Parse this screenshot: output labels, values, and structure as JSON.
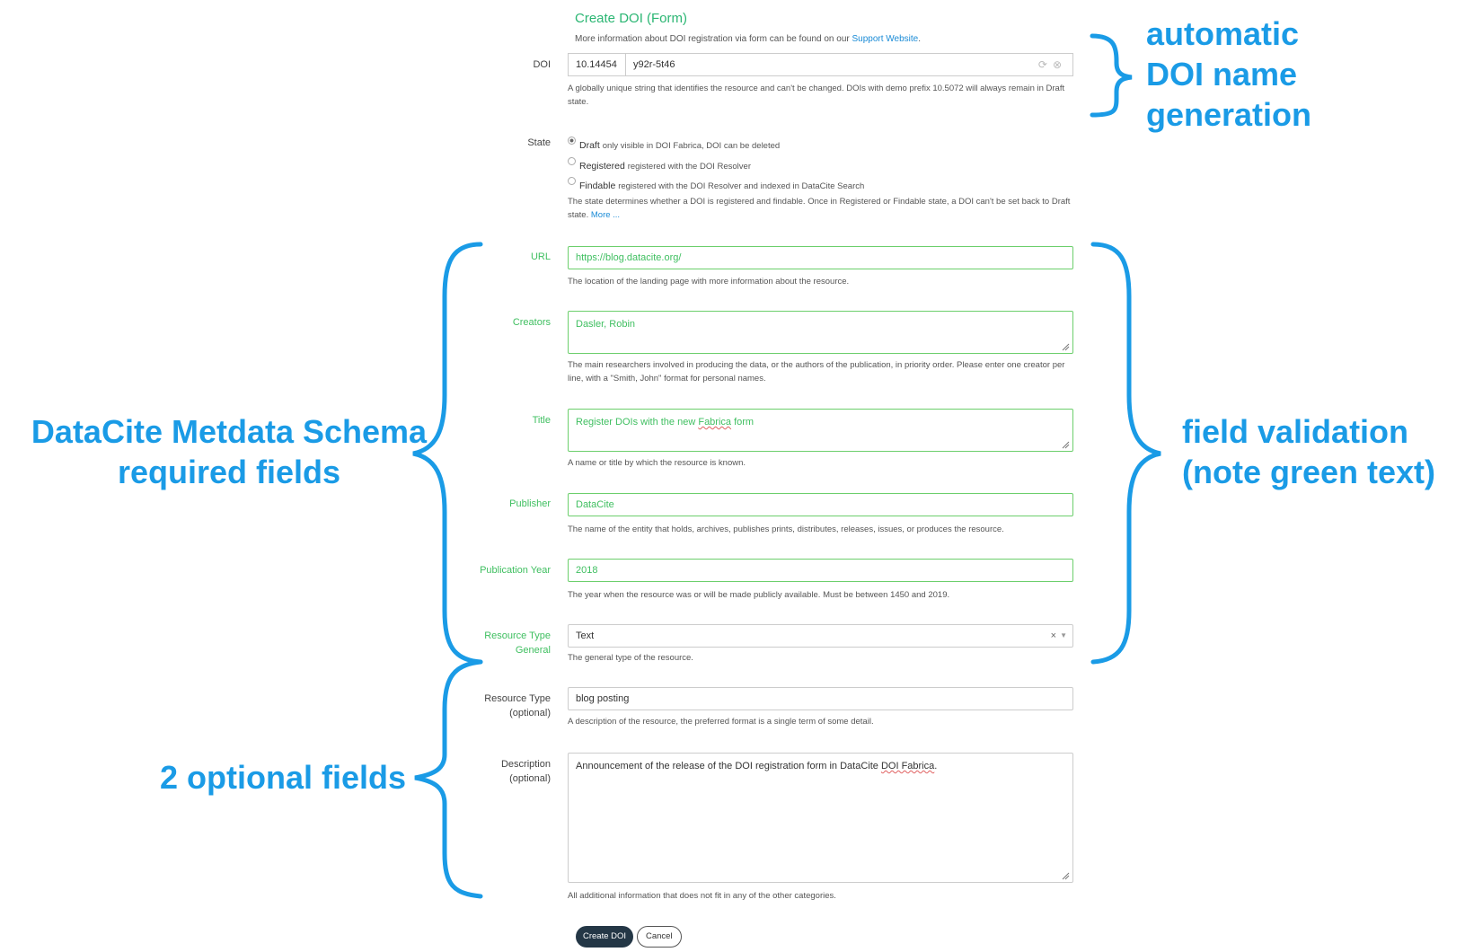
{
  "form": {
    "title": "Create DOI (Form)",
    "subtitle_prefix": "More information about DOI registration via form can be found on our ",
    "subtitle_link": "Support Website",
    "subtitle_suffix": "."
  },
  "doi": {
    "label": "DOI",
    "prefix": "10.14454",
    "suffix": "y92r-5t46",
    "help": "A globally unique string that identifies the resource and can't be changed. DOIs with demo prefix 10.5072 will always remain in Draft state."
  },
  "state": {
    "label": "State",
    "options": [
      {
        "name": "Draft",
        "desc": "only visible in DOI Fabrica, DOI can be deleted",
        "selected": true
      },
      {
        "name": "Registered",
        "desc": "registered with the DOI Resolver",
        "selected": false
      },
      {
        "name": "Findable",
        "desc": "registered with the DOI Resolver and indexed in DataCite Search",
        "selected": false
      }
    ],
    "help": "The state determines whether a DOI is registered and findable. Once in Registered or Findable state, a DOI can't be set back to Draft state. ",
    "help_link": "More ..."
  },
  "url": {
    "label": "URL",
    "value": "https://blog.datacite.org/",
    "help": "The location of the landing page with more information about the resource."
  },
  "creators": {
    "label": "Creators",
    "value": "Dasler, Robin",
    "help": "The main researchers involved in producing the data, or the authors of the publication, in priority order. Please enter one creator per line, with a \"Smith, John\" format for personal names."
  },
  "title_field": {
    "label": "Title",
    "value_before": "Register DOIs with the new ",
    "value_flagged": "Fabrica",
    "value_after": " form",
    "help": "A name or title by which the resource is known."
  },
  "publisher": {
    "label": "Publisher",
    "value": "DataCite",
    "help": "The name of the entity that holds, archives, publishes prints, distributes, releases, issues, or produces the resource."
  },
  "publication_year": {
    "label": "Publication Year",
    "value": "2018",
    "help": "The year when the resource was or will be made publicly available. Must be between 1450 and 2019."
  },
  "resource_type_general": {
    "label_line1": "Resource Type",
    "label_line2": "General",
    "value": "Text",
    "clear": "×",
    "help": "The general type of the resource."
  },
  "resource_type": {
    "label_line1": "Resource Type",
    "label_line2": "(optional)",
    "value": "blog posting",
    "help": "A description of the resource, the preferred format is a single term of some detail."
  },
  "description": {
    "label_line1": "Description",
    "label_line2": "(optional)",
    "value_before": "Announcement of the release of the DOI registration form in DataCite ",
    "value_flagged": "DOI Fabrica",
    "value_after": ".",
    "help": "All additional information that does not fit in any of the other categories."
  },
  "buttons": {
    "create": "Create DOI",
    "cancel": "Cancel"
  },
  "annotations": {
    "auto_doi": [
      "automatic",
      "DOI name",
      "generation"
    ],
    "required": [
      "DataCite Metdata Schema",
      "required fields"
    ],
    "validation": [
      "field validation",
      "(note green text)"
    ],
    "optional": "2 optional fields"
  },
  "colors": {
    "annotation": "#1a9be6",
    "valid_green": "#3fbf60",
    "title_green": "#2bb673",
    "link_blue": "#1a8bd6",
    "button_dark": "#243746"
  }
}
